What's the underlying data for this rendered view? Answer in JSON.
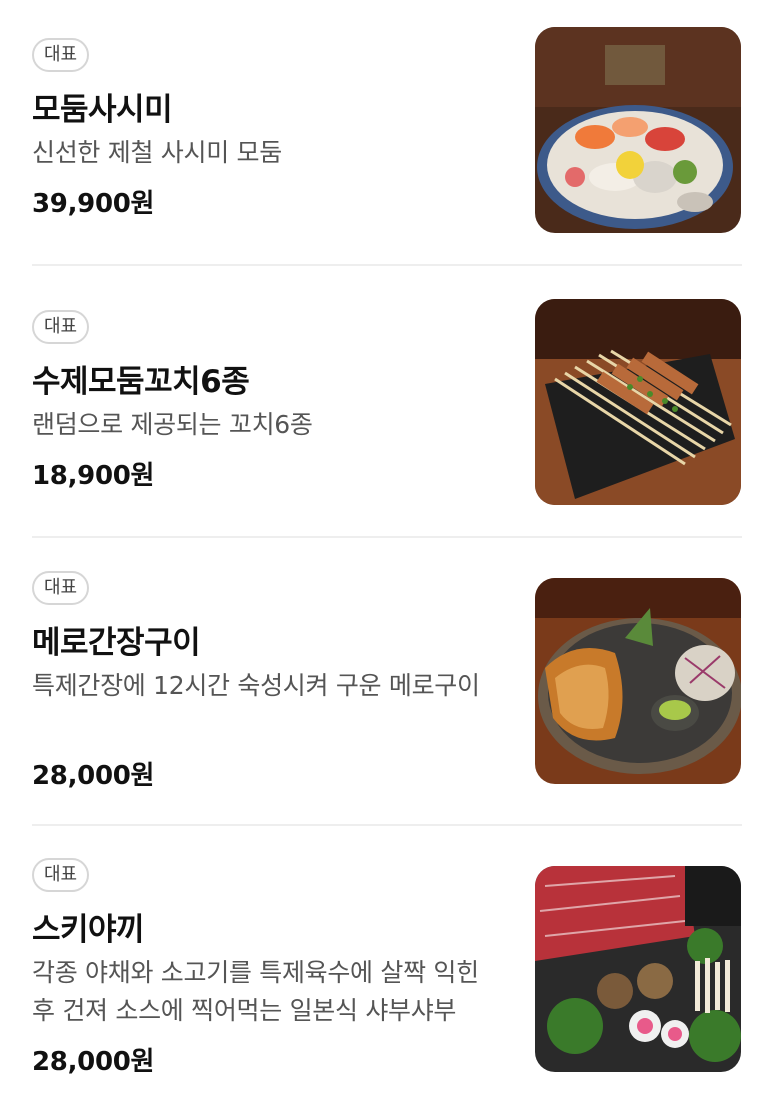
{
  "menu_items": [
    {
      "badge": "대표",
      "name": "모둠사시미",
      "description": "신선한 제철 사시미 모둠",
      "price": "39,900원",
      "image_icon": "sashimi-platter-photo"
    },
    {
      "badge": "대표",
      "name": "수제모둠꼬치6종",
      "description": "랜덤으로 제공되는 꼬치6종",
      "price": "18,900원",
      "image_icon": "skewers-photo"
    },
    {
      "badge": "대표",
      "name": "메로간장구이",
      "description": "특제간장에 12시간 숙성시켜 구운 메로구이",
      "price": "28,000원",
      "image_icon": "grilled-fish-photo"
    },
    {
      "badge": "대표",
      "name": "스키야끼",
      "description": "각종 야채와 소고기를 특제육수에 살짝 익힌 후 건져 소스에 찍어먹는 일본식 샤부샤부",
      "price": "28,000원",
      "image_icon": "sukiyaki-photo"
    }
  ]
}
